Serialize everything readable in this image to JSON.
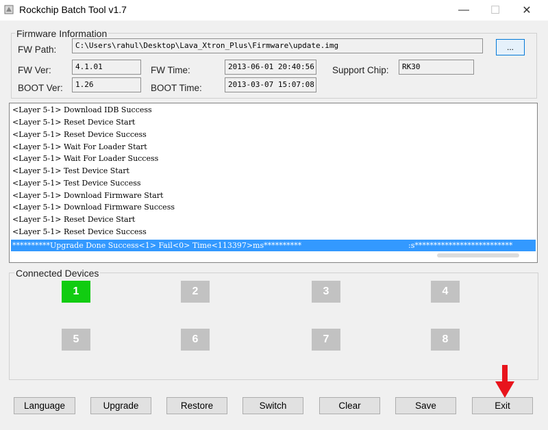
{
  "window": {
    "title": "Rockchip Batch Tool v1.7",
    "controls": {
      "minimize": "—",
      "maximize": "☐",
      "close": "✕"
    }
  },
  "firmware": {
    "group_title": "Firmware Information",
    "fw_path_label": "FW Path:",
    "fw_path_value": "C:\\Users\\rahul\\Desktop\\Lava_Xtron_Plus\\Firmware\\update.img",
    "browse_label": "...",
    "fw_ver_label": "FW Ver:",
    "fw_ver_value": "4.1.01",
    "fw_time_label": "FW Time:",
    "fw_time_value": "2013-06-01 20:40:56",
    "support_chip_label": "Support Chip:",
    "support_chip_value": "RK30",
    "boot_ver_label": "BOOT Ver:",
    "boot_ver_value": "1.26",
    "boot_time_label": "BOOT Time:",
    "boot_time_value": "2013-03-07 15:07:08"
  },
  "log": {
    "lines": [
      "<Layer 5-1> Download IDB Success",
      "<Layer 5-1> Reset Device Start",
      "<Layer 5-1> Reset Device Success",
      "<Layer 5-1> Wait For Loader Start",
      "<Layer 5-1> Wait For Loader Success",
      "<Layer 5-1> Test Device Start",
      "<Layer 5-1> Test Device Success",
      "<Layer 5-1> Download Firmware Start",
      "<Layer 5-1> Download Firmware Success",
      "<Layer 5-1> Reset Device Start",
      "<Layer 5-1> Reset Device Success"
    ],
    "selected_left": "**********Upgrade Done Success<1> Fail<0> Time<113397>ms**********",
    "selected_right": ":s**************************"
  },
  "devices": {
    "group_title": "Connected Devices",
    "tiles": [
      "1",
      "2",
      "3",
      "4",
      "5",
      "6",
      "7",
      "8"
    ],
    "active_color": "#11cc11",
    "inactive_color": "#c2c2c2"
  },
  "buttons": {
    "language": "Language",
    "upgrade": "Upgrade",
    "restore": "Restore",
    "switch": "Switch",
    "clear": "Clear",
    "save": "Save",
    "exit": "Exit"
  },
  "annotation": {
    "arrow_color": "#e8141c"
  }
}
